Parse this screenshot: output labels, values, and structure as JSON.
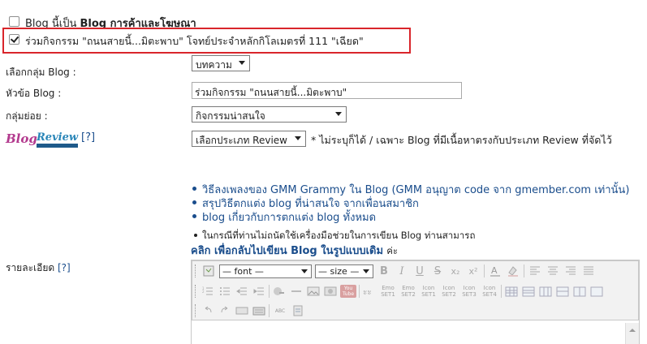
{
  "options": {
    "commercial_blog": {
      "label": "Blog นี้เป็น ",
      "label_bold": "Blog การค้าและโฆษณา",
      "checked": false
    },
    "join_activity": {
      "label": "ร่วมกิจกรรม \"ถนนสายนี้...มิตะพาบ\" โจทย์ประจำหลักกิโลเมตรที่ 111 \"เฉียด\"",
      "checked": true
    }
  },
  "form": {
    "blog_group": {
      "label": "เลือกกลุ่ม Blog :",
      "value": "บทความ"
    },
    "blog_title": {
      "label": "หัวข้อ Blog :",
      "value": "ร่วมกิจกรรม \"ถนนสายนี้...มิตะพาบ\""
    },
    "subgroup": {
      "label": "กลุ่มย่อย :",
      "value": "กิจกรรมน่าสนใจ"
    },
    "review": {
      "logo_text_1": "Blog",
      "logo_text_2": "Review",
      "help": "[?]",
      "value": "เลือกประเภท Review",
      "note": "* ไม่ระบุก็ได้ / เฉพาะ Blog ที่มีเนื้อหาตรงกับประเภท Review ที่จัดไว้"
    },
    "detail": {
      "label": "รายละเอียด",
      "help": "[?]"
    }
  },
  "links": [
    "วิธีลงเพลงของ GMM Grammy ใน Blog (GMM อนุญาต code จาก gmember.com เท่านั้น)",
    "สรุปวิธีตกแต่ง blog ที่น่าสนใจ จากเพื่อนสมาชิก",
    "blog เกี่ยวกับการตกแต่ง blog ทั้งหมด"
  ],
  "notice": {
    "text": "ในกรณีที่ท่านไม่ถนัดใช้เครื่องมือช่วยในการเขียน Blog ท่านสามารถ",
    "link": "คลิก เพื่อกลับไปเขียน Blog ในรูปแบบเดิม",
    "suffix": "ค่ะ"
  },
  "editor": {
    "font_select": "— font —",
    "size_select": "— size —",
    "format_buttons": [
      "B",
      "I",
      "U",
      "S",
      "x₂",
      "x²"
    ],
    "youtube_label": "You Tube",
    "emoticon_sets": [
      {
        "top": "Emo",
        "bottom": "SET1"
      },
      {
        "top": "Emo",
        "bottom": "SET2"
      },
      {
        "top": "Icon",
        "bottom": "SET1"
      },
      {
        "top": "Icon",
        "bottom": "SET2"
      },
      {
        "top": "Icon",
        "bottom": "SET3"
      },
      {
        "top": "Icon",
        "bottom": "SET4"
      }
    ],
    "spell_label": "ABC"
  },
  "colors": {
    "highlight_border": "#d9252b",
    "link": "#1a4d8c"
  }
}
